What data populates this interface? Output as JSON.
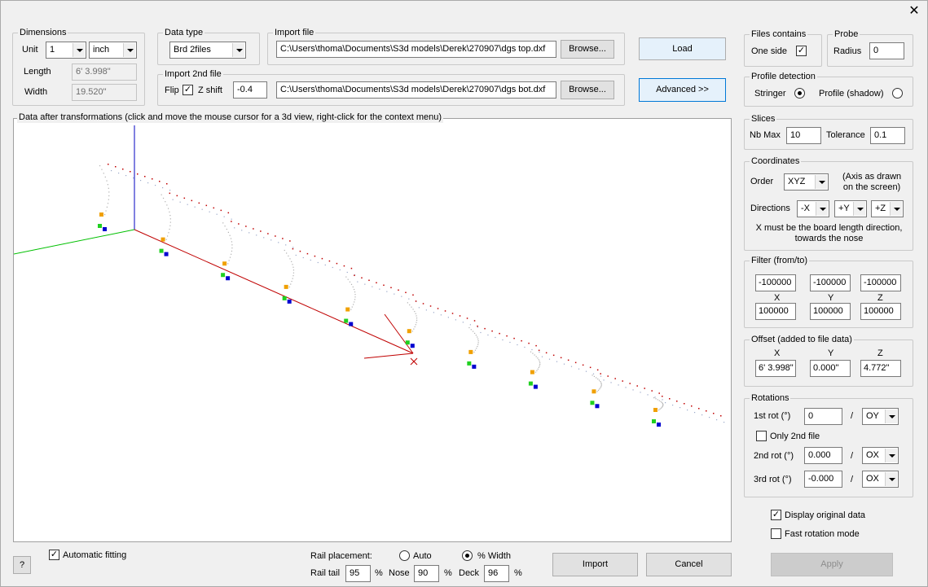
{
  "window": {
    "close_glyph": "✕"
  },
  "dimensions": {
    "title": "Dimensions",
    "unit_label": "Unit",
    "unit_value": "1",
    "unit_type": "inch",
    "length_label": "Length",
    "length_value": "6' 3.998\"",
    "width_label": "Width",
    "width_value": "19.520\""
  },
  "data_type": {
    "title": "Data type",
    "value": "Brd 2files"
  },
  "import_file": {
    "title": "Import file",
    "path": "C:\\Users\\thoma\\Documents\\S3d models\\Derek\\270907\\dgs top.dxf",
    "browse_label": "Browse..."
  },
  "import_2nd": {
    "title": "Import 2nd file",
    "flip_label": "Flip",
    "flip_checked": true,
    "zshift_label": "Z shift",
    "zshift_value": "-0.4",
    "path": "C:\\Users\\thoma\\Documents\\S3d models\\Derek\\270907\\dgs bot.dxf",
    "browse_label": "Browse..."
  },
  "buttons": {
    "load": "Load",
    "advanced": "Advanced >>",
    "import": "Import",
    "cancel": "Cancel",
    "apply": "Apply",
    "help": "?"
  },
  "files_contains": {
    "title": "Files contains",
    "one_side_label": "One side",
    "one_side_checked": true
  },
  "probe": {
    "title": "Probe",
    "radius_label": "Radius",
    "radius_value": "0"
  },
  "profile_detection": {
    "title": "Profile detection",
    "stringer_label": "Stringer",
    "shadow_label": "Profile (shadow)",
    "selected": "stringer"
  },
  "slices": {
    "title": "Slices",
    "nbmax_label": "Nb Max",
    "nbmax_value": "10",
    "tolerance_label": "Tolerance",
    "tolerance_value": "0.1"
  },
  "coordinates": {
    "title": "Coordinates",
    "order_label": "Order",
    "order_value": "XYZ",
    "axis_note": "(Axis as drawn\non the screen)",
    "directions_label": "Directions",
    "dir_x": "-X",
    "dir_y": "+Y",
    "dir_z": "+Z",
    "note": "X must be the board length direction,\ntowards the nose"
  },
  "filter": {
    "title": "Filter (from/to)",
    "from": [
      "-100000",
      "-100000",
      "-100000"
    ],
    "axes": [
      "X",
      "Y",
      "Z"
    ],
    "to": [
      "100000",
      "100000",
      "100000"
    ]
  },
  "offset": {
    "title": "Offset (added to file data)",
    "axes": [
      "X",
      "Y",
      "Z"
    ],
    "values": [
      "6' 3.998\"",
      "0.000\"",
      "4.772\""
    ]
  },
  "rotations": {
    "title": "Rotations",
    "rot1_label": "1st rot (°)",
    "rot1_value": "0",
    "rot1_axis": "OY",
    "only2nd_label": "Only 2nd file",
    "only2nd_checked": false,
    "rot2_label": "2nd rot (°)",
    "rot2_value": "0.000",
    "rot2_axis": "OX",
    "rot3_label": "3rd rot (°)",
    "rot3_value": "-0.000",
    "rot3_axis": "OX",
    "slash": "/"
  },
  "display_original": {
    "label": "Display original data",
    "checked": true
  },
  "fast_rotation": {
    "label": "Fast rotation mode",
    "checked": false
  },
  "view": {
    "title": "Data after transformations (click and move the mouse cursor for a 3d view, right-click for the context menu)"
  },
  "automatic_fitting": {
    "label": "Automatic fitting",
    "checked": true
  },
  "rail": {
    "placement_label": "Rail placement:",
    "auto_label": "Auto",
    "width_label": "% Width",
    "selected": "width",
    "tail_label": "Rail tail",
    "tail_value": "95",
    "nose_label": "Nose",
    "nose_value": "90",
    "deck_label": "Deck",
    "deck_value": "96",
    "pct": "%"
  },
  "colors": {
    "axis_x": "#c00000",
    "axis_y": "#00c000",
    "axis_z": "#0000c0",
    "point_orange": "#f0a000",
    "point_green": "#20d020",
    "point_blue": "#0000d0"
  }
}
